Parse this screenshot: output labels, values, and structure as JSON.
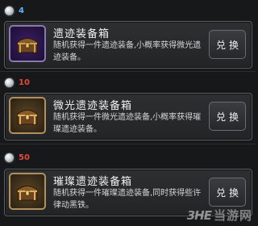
{
  "items": [
    {
      "cost": "4",
      "cost_color": "#5fb3ff",
      "title": "遗迹装备箱",
      "description": "随机获得一件遗迹装备,小概率获得微光遗迹装备。",
      "button": "兑换",
      "icon": "purple-chest-icon"
    },
    {
      "cost": "10",
      "cost_color": "#e04a3a",
      "title": "微光遗迹装备箱",
      "description": "随机获得一件微光遗迹装备,小概率获得璀璨遗迹装备。",
      "button": "兑换",
      "icon": "gold-chest-icon"
    },
    {
      "cost": "50",
      "cost_color": "#e04a3a",
      "title": "璀璨遗迹装备箱",
      "description": "随机获得一件璀璨遗迹装备,同时获得些许律动黑铁。",
      "button": "兑换",
      "icon": "gold-chest-icon"
    }
  ],
  "watermark": {
    "logo": "3HE",
    "text": "当游网"
  }
}
